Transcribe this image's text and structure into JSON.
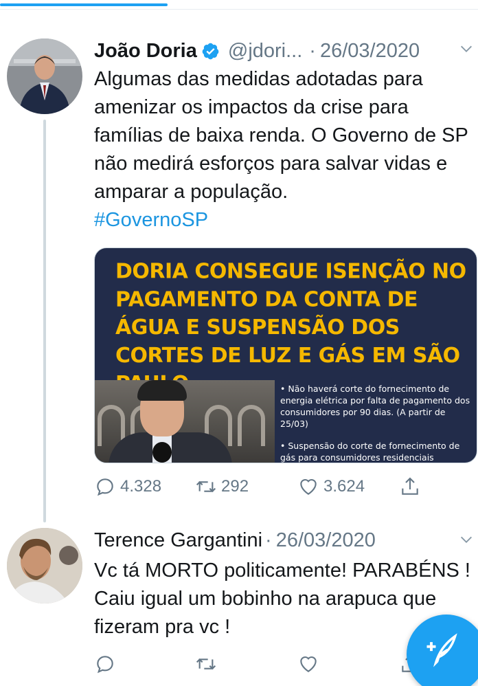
{
  "colors": {
    "accent": "#1da1f2",
    "hashtag": "#1b95e0",
    "meta": "#657786",
    "headline": "#f5b800",
    "media_bg": "#222c4a"
  },
  "tweets": [
    {
      "name": "João Doria",
      "verified": true,
      "handle": "@jdori...",
      "separator": "·",
      "date": "26/03/2020",
      "text": "Algumas das medidas adotadas para amenizar os impactos da crise para famílias de baixa renda. O Governo de SP não medirá esforços para salvar vidas e amparar a população.",
      "hashtag": "#GovernoSP",
      "media": {
        "headline": "DORIA CONSEGUE ISENÇÃO NO PAGAMENTO DA CONTA DE ÁGUA E SUSPENSÃO DOS CORTES DE LUZ E GÁS EM SÃO PAULO",
        "bullet1": "• Não haverá corte do fornecimento de energia elétrica por falta de pagamento dos consumidores por 90 dias. (A partir de 25/03)",
        "bullet2": "• Suspensão do corte de fornecimento de gás para consumidores residenciais"
      },
      "replies": "4.328",
      "retweets": "292",
      "likes": "3.624",
      "icons": {
        "reply": "reply-icon",
        "retweet": "retweet-icon",
        "like": "like-icon",
        "share": "share-icon",
        "menu": "chevron-down-icon",
        "verified": "verified-badge-icon"
      }
    },
    {
      "name": "Terence Gargantini",
      "separator": "·",
      "date": "26/03/2020",
      "text": "Vc tá MORTO politicamente! PARABÉNS ! Caiu igual um bobinho na arapuca que fizeram pra vc !",
      "replies": "",
      "retweets": "",
      "likes": ""
    }
  ],
  "compose_button": {
    "icon": "compose-tweet-icon"
  }
}
